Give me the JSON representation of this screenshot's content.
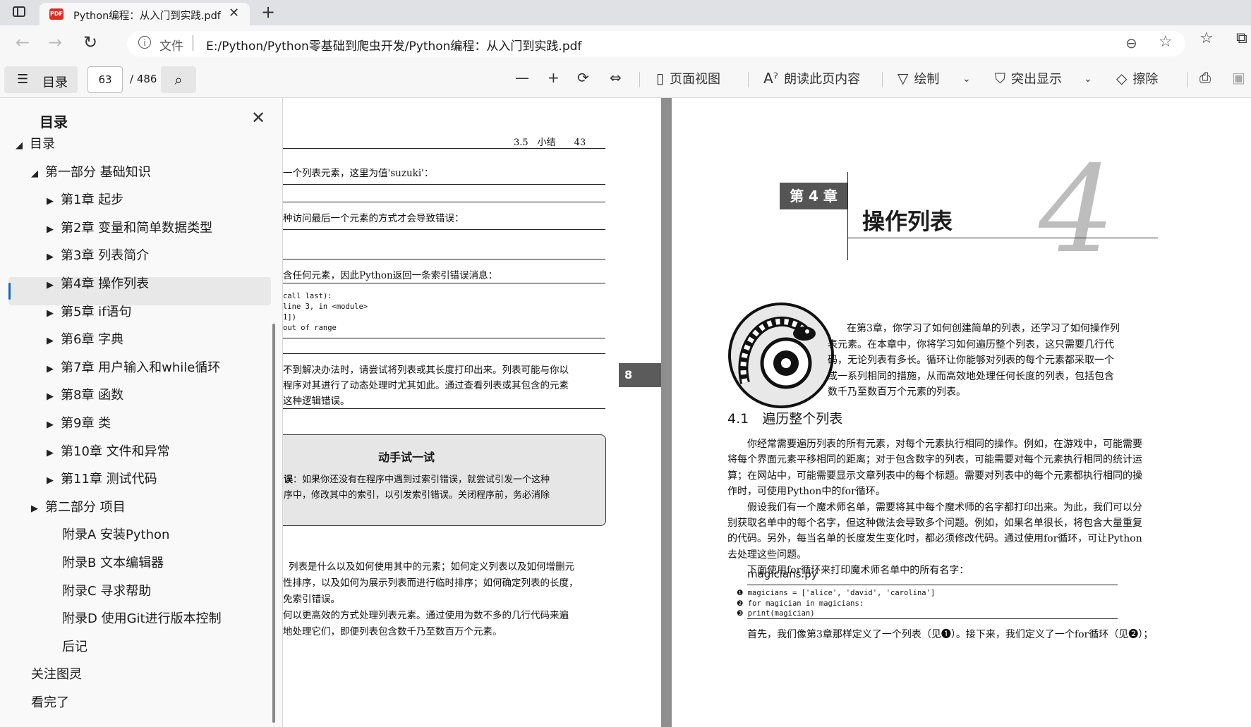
{
  "browser": {
    "tab_title": "Python编程：从入门到实践.pdf",
    "tab_pdf_badge": "PDF",
    "close_glyph": "✕",
    "newtab_glyph": "+",
    "address_label": "文件",
    "url": "E:/Python/Python零基础到爬虫开发/Python编程：从入门到实践.pdf"
  },
  "toolbar": {
    "toc_label": "目录",
    "page_current": "63",
    "page_total": "/ 486",
    "page_view": "页面视图",
    "read_aloud": "朗读此页内容",
    "draw": "绘制",
    "highlight": "突出显示",
    "erase": "擦除"
  },
  "sidebar": {
    "header": "目录",
    "items": [
      {
        "label": "目录",
        "arrow": "◢"
      },
      {
        "label": "第一部分 基础知识",
        "arrow": "◢"
      },
      {
        "label": "第1章 起步",
        "arrow": "▶"
      },
      {
        "label": "第2章 变量和简单数据类型",
        "arrow": "▶"
      },
      {
        "label": "第3章 列表简介",
        "arrow": "▶"
      },
      {
        "label": "第4章 操作列表",
        "arrow": "▶"
      },
      {
        "label": "第5章 if语句",
        "arrow": "▶"
      },
      {
        "label": "第6章 字典",
        "arrow": "▶"
      },
      {
        "label": "第7章 用户输入和while循环",
        "arrow": "▶"
      },
      {
        "label": "第8章 函数",
        "arrow": "▶"
      },
      {
        "label": "第9章 类",
        "arrow": "▶"
      },
      {
        "label": "第10章 文件和异常",
        "arrow": "▶"
      },
      {
        "label": "第11章 测试代码",
        "arrow": "▶"
      },
      {
        "label": "第二部分 项目",
        "arrow": "▶"
      },
      {
        "label": "附录A 安装Python",
        "arrow": ""
      },
      {
        "label": "附录B 文本编辑器",
        "arrow": ""
      },
      {
        "label": "附录C 寻求帮助",
        "arrow": ""
      },
      {
        "label": "附录D 使用Git进行版本控制",
        "arrow": ""
      },
      {
        "label": "后记",
        "arrow": ""
      },
      {
        "label": "关注图灵",
        "arrow": ""
      },
      {
        "label": "看完了",
        "arrow": ""
      }
    ]
  },
  "left_page": {
    "running_head": "3.5　小结　　43",
    "line1": "一个列表元素，这里为值'suzuki'：",
    "line2": "种访问最后一个元素的方式才会导致错误：",
    "line3": "含任何元素，因此Python返回一条索引错误消息：",
    "code": [
      "call last):",
      " line 3, in <module>",
      "1])",
      "out of range"
    ],
    "note1": "不到解决办法时，请尝试将列表或其长度打印出来。列表可能与你以",
    "note2": "程序对其进行了动态处理时尤其如此。通过查看列表或其包含的元素",
    "note3": "这种逻辑错误。",
    "try_title": "动手试一试",
    "try1_bold": "误",
    "try1": "：如果你还没有在程序中遇到过索引错误，就尝试引发一个这种",
    "try2": "序中，修改其中的索引，以引发索引错误。关闭程序前，务必消除",
    "sum1": "列表是什么以及如何使用其中的元素；如何定义列表以及如何增删元",
    "sum2": "性排序，以及如何为展示列表而进行临时排序；如何确定列表的长度，",
    "sum3": "免索引错误。",
    "sum4": "何以更高效的方式处理列表元素。通过使用为数不多的几行代码来遍",
    "sum5": "地处理它们，即便列表包含数千乃至数百万个元素。",
    "side_tab": "8"
  },
  "right_page": {
    "chapter_box": "第 4 章",
    "chapter_title": "操作列表",
    "chapter_number": "4",
    "intro": [
      "在第3章，你学习了如何创建简单的列表，还学习了如何操作列",
      "表元素。在本章中，你将学习如何遍历整个列表，这只需要几行代",
      "码，无论列表有多长。循环让你能够对列表的每个元素都采取一个",
      "或一系列相同的措施，从而高效地处理任何长度的列表，包括包含",
      "数千乃至数百万个元素的列表。"
    ],
    "section": "4.1　遍历整个列表",
    "body": [
      "你经常需要遍历列表的所有元素，对每个元素执行相同的操作。例如，在游戏中，可能需要",
      "将每个界面元素平移相同的距离；对于包含数字的列表，可能需要对每个元素执行相同的统计运",
      "算；在网站中，可能需要显示文章列表中的每个标题。需要对列表中的每个元素都执行相同的操",
      "作时，可使用Python中的for循环。",
      "假设我们有一个魔术师名单，需要将其中每个魔术师的名字都打印出来。为此，我们可以分",
      "别获取名单中的每个名字，但这种做法会导致多个问题。例如，如果名单很长，将包含大量重复",
      "的代码。另外，每当名单的长度发生变化时，都必须修改代码。通过使用for循环，可让Python",
      "去处理这些问题。",
      "下面使用for循环来打印魔术师名单中的所有名字："
    ],
    "filename": "magicians.py",
    "code": [
      "❶ magicians = ['alice', 'david', 'carolina']",
      "❷ for magician in magicians:",
      "❸     print(magician)"
    ],
    "last_line": "首先，我们像第3章那样定义了一个列表（见❶）。接下来，我们定义了一个for循环（见❷）；"
  }
}
